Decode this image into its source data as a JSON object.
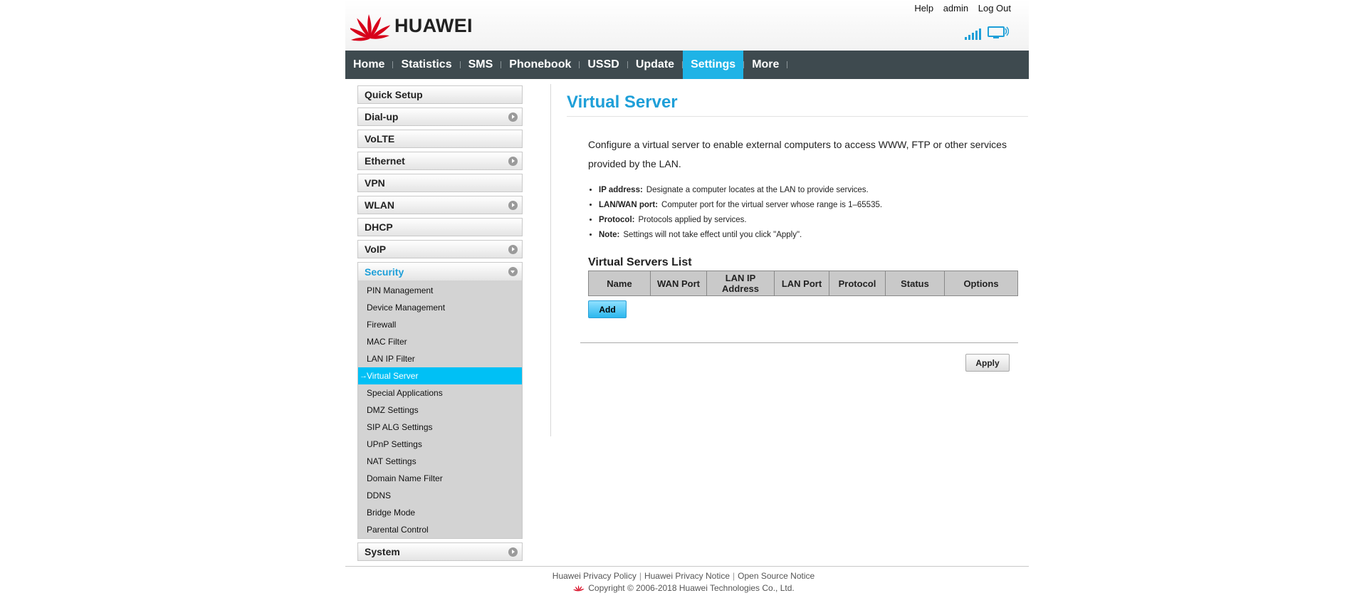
{
  "header": {
    "brand": "HUAWEI",
    "links": {
      "help": "Help",
      "user": "admin",
      "logout": "Log Out"
    },
    "colors": {
      "logo_red": "#d7001a",
      "icon_blue": "#1e9fd8"
    }
  },
  "nav": {
    "items": [
      "Home",
      "Statistics",
      "SMS",
      "Phonebook",
      "USSD",
      "Update",
      "Settings",
      "More"
    ],
    "active": "Settings",
    "colors": {
      "bar": "#3e4a4f",
      "active": "#1fb3e6"
    }
  },
  "sidebar": {
    "items": [
      {
        "label": "Quick Setup",
        "has_arrow": false
      },
      {
        "label": "Dial-up",
        "has_arrow": true
      },
      {
        "label": "VoLTE",
        "has_arrow": false
      },
      {
        "label": "Ethernet",
        "has_arrow": true
      },
      {
        "label": "VPN",
        "has_arrow": false
      },
      {
        "label": "WLAN",
        "has_arrow": true
      },
      {
        "label": "DHCP",
        "has_arrow": false
      },
      {
        "label": "VoIP",
        "has_arrow": true
      },
      {
        "label": "Security",
        "has_arrow": true,
        "expanded": true
      },
      {
        "label": "System",
        "has_arrow": true
      }
    ],
    "security_submenu": [
      "PIN Management",
      "Device Management",
      "Firewall",
      "MAC Filter",
      "LAN IP Filter",
      "Virtual Server",
      "Special Applications",
      "DMZ Settings",
      "SIP ALG Settings",
      "UPnP Settings",
      "NAT Settings",
      "Domain Name Filter",
      "DDNS",
      "Bridge Mode",
      "Parental Control"
    ],
    "active_submenu": "Virtual Server"
  },
  "main": {
    "title": "Virtual Server",
    "intro": "Configure a virtual server to enable external computers to access WWW, FTP or other services provided by the LAN.",
    "notes": [
      {
        "term": "IP address:",
        "text": "Designate a computer locates at the LAN to provide services."
      },
      {
        "term": "LAN/WAN port:",
        "text": "Computer port for the virtual server whose range is 1–65535."
      },
      {
        "term": "Protocol:",
        "text": "Protocols applied by services."
      },
      {
        "term": "Note:",
        "text": "Settings will not take effect until you click \"Apply\"."
      }
    ],
    "list_title": "Virtual Servers List",
    "table_headers": [
      "Name",
      "WAN Port",
      "LAN IP Address",
      "LAN Port",
      "Protocol",
      "Status",
      "Options"
    ],
    "add_label": "Add",
    "apply_label": "Apply"
  },
  "footer": {
    "links": [
      "Huawei Privacy Policy",
      "Huawei Privacy Notice",
      "Open Source Notice"
    ],
    "copyright": "Copyright © 2006-2018 Huawei Technologies Co., Ltd."
  }
}
